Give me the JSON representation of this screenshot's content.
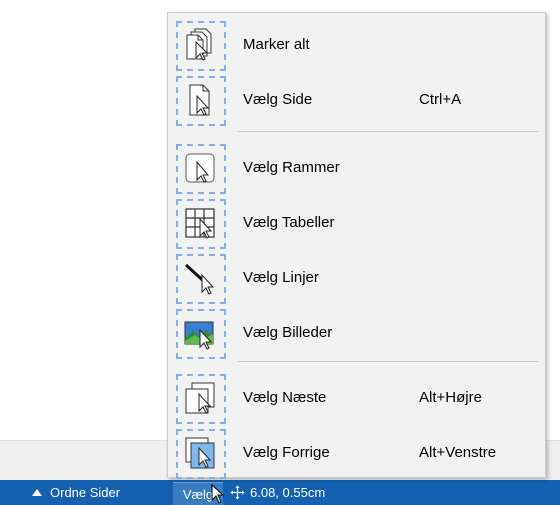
{
  "menu": {
    "items": [
      {
        "label": "Marker alt",
        "shortcut": "",
        "icon": "select-all-icon"
      },
      {
        "label": "Vælg Side",
        "shortcut": "Ctrl+A",
        "icon": "select-page-icon"
      },
      {
        "label": "Vælg Rammer",
        "shortcut": "",
        "icon": "select-frames-icon"
      },
      {
        "label": "Vælg Tabeller",
        "shortcut": "",
        "icon": "select-tables-icon"
      },
      {
        "label": "Vælg Linjer",
        "shortcut": "",
        "icon": "select-lines-icon"
      },
      {
        "label": "Vælg Billeder",
        "shortcut": "",
        "icon": "select-images-icon"
      },
      {
        "label": "Vælg Næste",
        "shortcut": "Alt+Højre",
        "icon": "select-next-icon"
      },
      {
        "label": "Vælg Forrige",
        "shortcut": "Alt+Venstre",
        "icon": "select-previous-icon"
      }
    ]
  },
  "statusbar": {
    "pages_label": "Ordne Sider",
    "select_label": "Vælg",
    "coordinates": "6.08, 0.55cm"
  },
  "colors": {
    "statusbar": "#1461b1",
    "menu_background": "#f2f2f2",
    "icon_dash": "#86aee6",
    "frame_fill": "#7fb8ee"
  }
}
